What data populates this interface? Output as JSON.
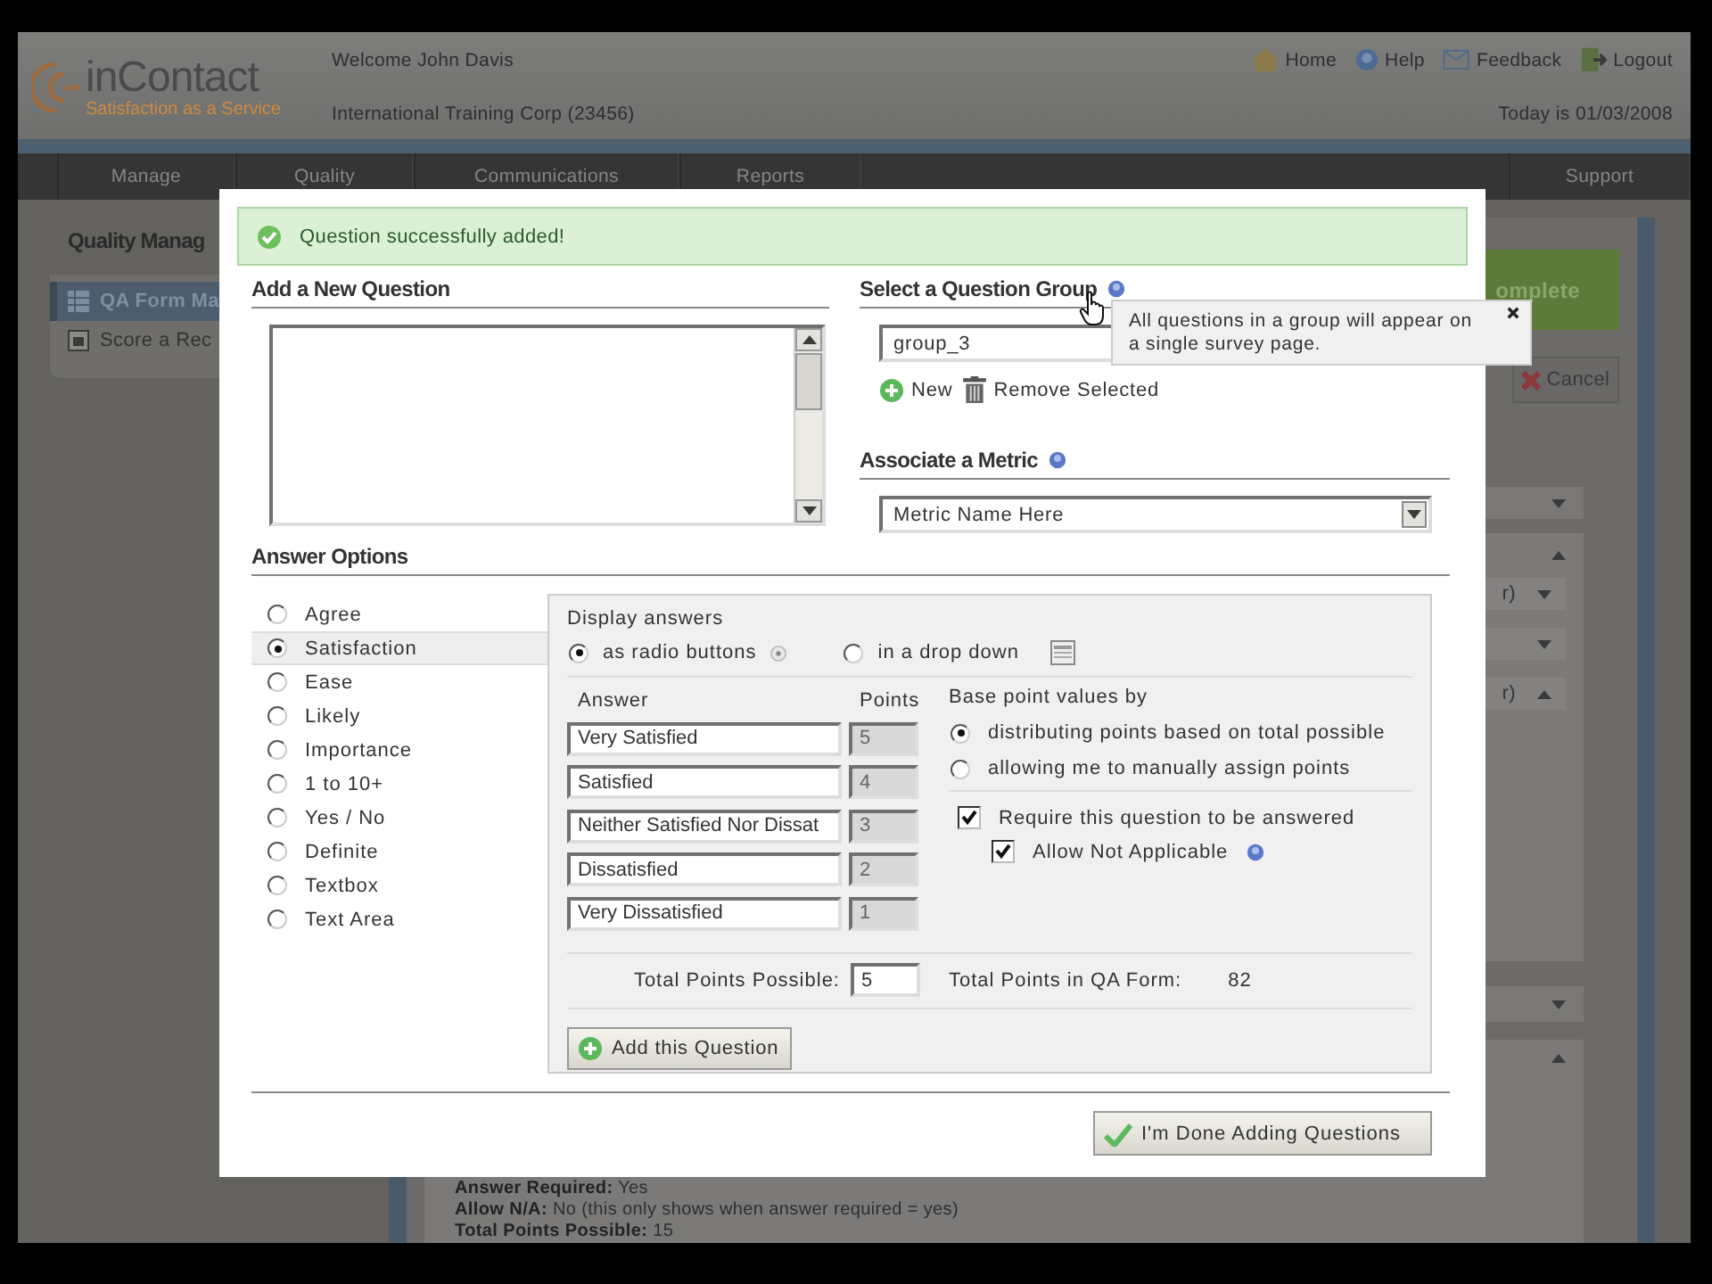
{
  "header": {
    "logo": {
      "name": "inContact",
      "tagline": "Satisfaction as a Service"
    },
    "welcome": "Welcome John Davis",
    "company": "International Training Corp (23456)",
    "links": [
      {
        "label": "Home"
      },
      {
        "label": "Help"
      },
      {
        "label": "Feedback"
      },
      {
        "label": "Logout"
      }
    ],
    "date": "Today is 01/03/2008"
  },
  "nav": [
    {
      "label": "Manage"
    },
    {
      "label": "Quality"
    },
    {
      "label": "Communications"
    },
    {
      "label": "Reports"
    },
    {
      "label": "Support"
    }
  ],
  "sidebar": {
    "title": "Quality Manag",
    "items": [
      {
        "label": "QA Form Ma",
        "selected": true
      },
      {
        "label": "Score a Rec",
        "selected": false
      }
    ]
  },
  "background_panel": {
    "complete_button": "omplete",
    "cancel_button": "Cancel",
    "fragments": [
      "r)",
      "r)"
    ],
    "summary": [
      {
        "label": "Answer Required:",
        "value": "Yes"
      },
      {
        "label": "Allow N/A:",
        "value": "No (this only shows when answer required = yes)"
      },
      {
        "label": "Total Points Possible:",
        "value": "15"
      }
    ]
  },
  "dialog": {
    "message": "Question successfully added!",
    "question": {
      "heading": "Add a New Question"
    },
    "group": {
      "heading": "Select a Question Group",
      "value": "group_3",
      "actions": [
        {
          "label": "New"
        },
        {
          "label": "Remove Selected"
        }
      ],
      "tooltip": "All questions in a group will appear on a single survey page."
    },
    "metric": {
      "heading": "Associate a Metric",
      "value": "Metric Name Here"
    },
    "answer_options": {
      "heading": "Answer Options",
      "types": [
        {
          "label": "Agree",
          "selected": false
        },
        {
          "label": "Satisfaction",
          "selected": true
        },
        {
          "label": "Ease",
          "selected": false
        },
        {
          "label": "Likely",
          "selected": false
        },
        {
          "label": "Importance",
          "selected": false
        },
        {
          "label": "1 to 10+",
          "selected": false
        },
        {
          "label": "Yes / No",
          "selected": false
        },
        {
          "label": "Definite",
          "selected": false
        },
        {
          "label": "Textbox",
          "selected": false
        },
        {
          "label": "Text Area",
          "selected": false
        }
      ]
    },
    "display": {
      "label": "Display answers",
      "modes": [
        {
          "label": "as radio buttons",
          "selected": true
        },
        {
          "label": "in a drop down",
          "selected": false
        }
      ]
    },
    "answers": {
      "columns": [
        "Answer",
        "Points"
      ],
      "points_disabled": true,
      "rows": [
        {
          "answer": "Very Satisfied",
          "points": "5"
        },
        {
          "answer": "Satisfied",
          "points": "4"
        },
        {
          "answer": "Neither Satisfied Nor Dissat",
          "points": "3"
        },
        {
          "answer": "Dissatisfied",
          "points": "2"
        },
        {
          "answer": "Very Dissatisfied",
          "points": "1"
        }
      ]
    },
    "base_points": {
      "label": "Base point values by",
      "options": [
        {
          "label": "distributing points based on total possible",
          "selected": true
        },
        {
          "label": "allowing me to manually assign points",
          "selected": false
        }
      ]
    },
    "options": [
      {
        "label": "Require this question to be answered",
        "checked": true,
        "children": [
          {
            "label": "Allow Not Applicable",
            "checked": true
          }
        ]
      }
    ],
    "total_possible": {
      "label": "Total Points Possible:",
      "value": "5"
    },
    "total_form": {
      "label": "Total Points in QA Form:",
      "value": "82"
    },
    "add_button": "Add this Question",
    "done_button": "I'm Done Adding Questions"
  }
}
